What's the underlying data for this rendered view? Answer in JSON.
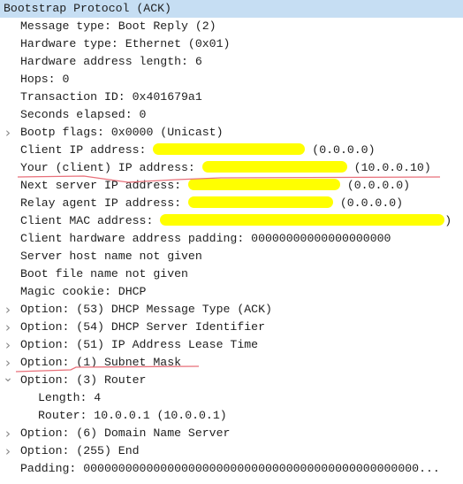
{
  "tree": {
    "header": "Bootstrap Protocol (ACK)",
    "rows": [
      {
        "label": "Message type: Boot Reply (2)"
      },
      {
        "label": "Hardware type: Ethernet (0x01)"
      },
      {
        "label": "Hardware address length: 6"
      },
      {
        "label": "Hops: 0"
      },
      {
        "label": "Transaction ID: 0x401679a1"
      },
      {
        "label": "Seconds elapsed: 0"
      },
      {
        "label": "Bootp flags: 0x0000 (Unicast)",
        "expander": "collapsed"
      },
      {
        "label": "Client IP address: ",
        "suffix": " (0.0.0.0)",
        "redacted": true
      },
      {
        "label": "Your (client) IP address: ",
        "suffix": " (10.0.0.10)",
        "redacted": true
      },
      {
        "label": "Next server IP address: ",
        "suffix": " (0.0.0.0)",
        "redacted": true
      },
      {
        "label": "Relay agent IP address: ",
        "suffix": " (0.0.0.0)",
        "redacted": true
      },
      {
        "label": "Client MAC address: ",
        "suffix": ")",
        "redacted": true
      },
      {
        "label": "Client hardware address padding: 00000000000000000000"
      },
      {
        "label": "Server host name not given"
      },
      {
        "label": "Boot file name not given"
      },
      {
        "label": "Magic cookie: DHCP"
      },
      {
        "label": "Option: (53) DHCP Message Type (ACK)",
        "expander": "collapsed"
      },
      {
        "label": "Option: (54) DHCP Server Identifier",
        "expander": "collapsed"
      },
      {
        "label": "Option: (51) IP Address Lease Time",
        "expander": "collapsed"
      },
      {
        "label": "Option: (1) Subnet Mask",
        "expander": "collapsed"
      },
      {
        "label": "Option: (3) Router",
        "expander": "expanded"
      },
      {
        "label": "Length: 4",
        "level": 2
      },
      {
        "label": "Router: 10.0.0.1 (10.0.0.1)",
        "level": 2
      },
      {
        "label": "Option: (6) Domain Name Server",
        "expander": "collapsed"
      },
      {
        "label": "Option: (255) End",
        "expander": "collapsed"
      },
      {
        "label": "Padding: 000000000000000000000000000000000000000000000000..."
      }
    ]
  },
  "colors": {
    "selection": "#c6def3",
    "redaction": "#ffff00",
    "annotation": "#e8707a"
  }
}
